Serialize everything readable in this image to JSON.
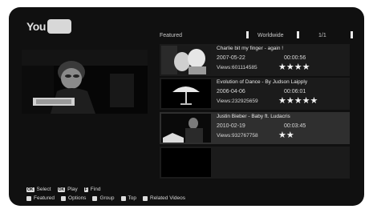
{
  "app": {
    "logo_text": "You",
    "logo_badge": "Tube"
  },
  "header": {
    "category": "Featured",
    "region": "Worldwide",
    "page": "1/1"
  },
  "colors": {
    "background": "#101010",
    "row": "#1b1b1b",
    "row_selected": "#2f2f2f",
    "text": "#e8e8e8"
  },
  "videos": [
    {
      "title": "Charlie bit my finger - again !",
      "date": "2007-05-22",
      "duration": "00:00:56",
      "views": "Views:601114585",
      "stars": "★★★★",
      "rating": 4
    },
    {
      "title": "Evolution of Dance - By Judson Laipply",
      "date": "2006-04-06",
      "duration": "00:06:01",
      "views": "Views:232925659",
      "stars": "★★★★★",
      "rating": 5
    },
    {
      "title": "Justin Bieber - Baby ft. Ludacris",
      "date": "2010-02-19",
      "duration": "00:03:45",
      "views": "Views:932767758",
      "stars": "★★",
      "rating": 2
    }
  ],
  "footer": {
    "line1": [
      {
        "key": "OK",
        "label": "Select"
      },
      {
        "key": "OK",
        "label": "Play"
      },
      {
        "key": "F",
        "label": "Find"
      }
    ],
    "line2": [
      {
        "label": "Featured"
      },
      {
        "label": "Options"
      },
      {
        "label": "Group"
      },
      {
        "label": "Top"
      },
      {
        "label": "Related Videos"
      }
    ]
  }
}
